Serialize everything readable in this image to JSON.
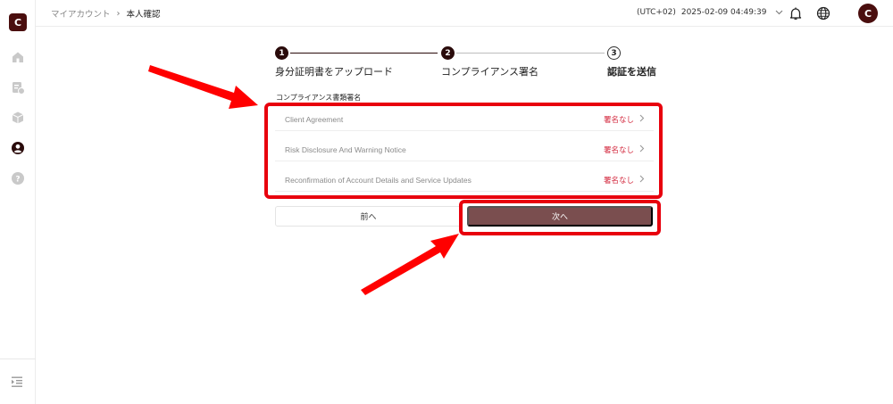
{
  "app": {
    "logo_text": "C"
  },
  "sidebar": {
    "items": [
      {
        "icon": "home-icon"
      },
      {
        "icon": "transfer-icon"
      },
      {
        "icon": "box-icon"
      },
      {
        "icon": "user-icon",
        "active": true
      },
      {
        "icon": "help-icon"
      }
    ],
    "collapse_icon": "collapse-menu-icon"
  },
  "header": {
    "breadcrumb": {
      "parent": "マイアカウント",
      "separator": "›",
      "current": "本人確認"
    },
    "timezone": "(UTC+02)",
    "datetime": "2025-02-09 04:49:39",
    "avatar_text": "C"
  },
  "stepper": {
    "steps": [
      {
        "number": "1",
        "label": "身分証明書をアップロード"
      },
      {
        "number": "2",
        "label": "コンプライアンス署名"
      },
      {
        "number": "3",
        "label": "認証を送信"
      }
    ]
  },
  "section_title": "コンプライアンス書類署名",
  "documents": [
    {
      "name": "Client Agreement",
      "status": "署名なし"
    },
    {
      "name": "Risk Disclosure And Warning Notice",
      "status": "署名なし"
    },
    {
      "name": "Reconfirmation of Account Details and Service Updates",
      "status": "署名なし"
    }
  ],
  "buttons": {
    "prev": "前へ",
    "next": "次へ"
  },
  "colors": {
    "brand": "#4a0e0e",
    "status_unsigned": "#d32a3f",
    "next_button": "#7a4e4f",
    "highlight": "#e8000d"
  }
}
